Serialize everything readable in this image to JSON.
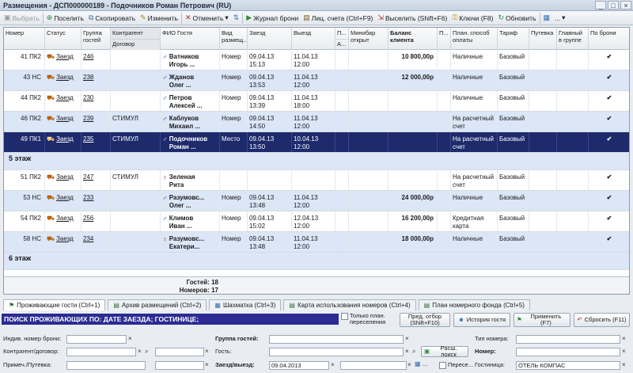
{
  "window": {
    "title": "Размещения - ДСП000000189 - Подочников Роман Петрович (RU)",
    "controls": [
      "_",
      "□",
      "×"
    ]
  },
  "toolbar": {
    "select": "Выбрать",
    "checkin": "Поселить",
    "copy": "Скопировать",
    "edit": "Изменить",
    "cancel": "Отменить",
    "booking_log": "Журнал брони",
    "personal_accounts": "Лиц. счета (Ctrl+F9)",
    "checkout": "Выселить (Shift+F6)",
    "keys": "Ключи (F8)",
    "refresh": "Обновить",
    "more": "..."
  },
  "columns": {
    "room": "Номер",
    "status": "Статус",
    "group": "Группа гостей",
    "contractor": "Контрагент",
    "contract": "Договор",
    "guest": "ФИО Гостя",
    "stay_type": "Вид размещ...",
    "arrival": "Заезд",
    "departure": "Выезд",
    "p": "П...",
    "a": "А...",
    "minibar": "Минибар открыт",
    "balance": "Баланс клиента",
    "p2": "П...",
    "payment": "План. способ оплаты",
    "tariff": "Тариф",
    "voucher": "Путевка",
    "main_in_group": "Главный в группе",
    "by_booking": "По брони"
  },
  "rows": [
    {
      "room": "41 ПК2",
      "status": "Заезд",
      "group": "246",
      "contractor": "",
      "guest": [
        "Ватников",
        "Игорь ..."
      ],
      "gender": "m",
      "stay": "Номер",
      "arrival": "09.04.13 15:13",
      "departure": "11.04.13 12:00",
      "balance": "10 800,00р",
      "payment": [
        "Наличные"
      ],
      "tariff": "Базовый",
      "by_booking": "✔",
      "style": "white"
    },
    {
      "room": "43 НС",
      "status": "Заезд",
      "group": "238",
      "contractor": "",
      "guest": [
        "Жданов",
        "Олег ..."
      ],
      "gender": "m",
      "stay": "Номер",
      "arrival": "09.04.13 13:53",
      "departure": "11.04.13 12:00",
      "balance": "12 000,00р",
      "payment": [
        "Наличные"
      ],
      "tariff": "Базовый",
      "by_booking": "✔",
      "style": "blue"
    },
    {
      "room": "44 ПК2",
      "status": "Заезд",
      "group": "230",
      "contractor": "",
      "guest": [
        "Петров",
        "Алексей ..."
      ],
      "gender": "m",
      "stay": "Номер",
      "arrival": "09.04.13 13:39",
      "departure": "11.04.13 18:00",
      "balance": "",
      "payment": [
        "Наличные"
      ],
      "tariff": "Базовый",
      "by_booking": "✔",
      "style": "white"
    },
    {
      "room": "46 ПК2",
      "status": "Заезд",
      "group": "239",
      "contractor": "СТИМУЛ",
      "guest": [
        "Каблуков",
        "Михаил ..."
      ],
      "gender": "m",
      "stay": "Номер",
      "arrival": "09.04.13 14:50",
      "departure": "11.04.13 12:00",
      "balance": "",
      "payment": [
        "На расчетный",
        "счет"
      ],
      "tariff": "Базовый",
      "by_booking": "✔",
      "style": "blue"
    },
    {
      "room": "49 ПК1",
      "status": "Заезд",
      "group": "235",
      "contractor": "СТИМУЛ",
      "guest": [
        "Подочников",
        "Роман ..."
      ],
      "gender": "m",
      "stay": "Место",
      "arrival": "09.04.13 13:50",
      "departure": "10.04.13 12:00",
      "balance": "",
      "payment": [
        "На расчетный",
        "счет"
      ],
      "tariff": "Базовый",
      "by_booking": "✔",
      "style": "sel"
    },
    {
      "floor": "5 этаж"
    },
    {
      "room": "51 ПК2",
      "status": "Заезд",
      "group": "247",
      "contractor": "СТИМУЛ",
      "guest": [
        "Зеленая",
        "Рита"
      ],
      "gender": "f",
      "stay": "",
      "arrival": "",
      "departure": "",
      "balance": "",
      "payment": [
        "На расчетный",
        "счет"
      ],
      "tariff": "Базовый",
      "by_booking": "✔",
      "style": "white"
    },
    {
      "room": "53 НС",
      "status": "Заезд",
      "group": "233",
      "contractor": "",
      "guest": [
        "Разумовс...",
        "Олег ..."
      ],
      "gender": "m",
      "stay": "Номер",
      "arrival": "09.04.13 13:48",
      "departure": "11.04.13 12:00",
      "balance": "24 000,00р",
      "payment": [
        "Наличные"
      ],
      "tariff": "Базовый",
      "by_booking": "✔",
      "style": "blue"
    },
    {
      "room": "54 ПК2",
      "status": "Заезд",
      "group": "256",
      "contractor": "",
      "guest": [
        "Климов",
        "Иван ..."
      ],
      "gender": "m",
      "stay": "Номер",
      "arrival": "09.04.13 15:02",
      "departure": "12.04.13 12:00",
      "balance": "16 200,00р",
      "payment": [
        "Кредитная",
        "карта"
      ],
      "tariff": "Базовый",
      "by_booking": "✔",
      "style": "white"
    },
    {
      "room": "58 НС",
      "status": "Заезд",
      "group": "234",
      "contractor": "",
      "guest": [
        "Разумовс...",
        "Екатери..."
      ],
      "gender": "f",
      "stay": "Номер",
      "arrival": "09.04.13 13:48",
      "departure": "11.04.13 12:00",
      "balance": "18 000,00р",
      "payment": [
        "Наличные"
      ],
      "tariff": "Базовый",
      "by_booking": "✔",
      "style": "blue"
    },
    {
      "floor": "6 этаж"
    }
  ],
  "summary": {
    "guests": "Гостей: 18",
    "rooms": "Номеров: 17"
  },
  "tabs": [
    "Проживающие гости (Ctrl+1)",
    "Архив размещений (Ctrl+2)",
    "Шахматка (Ctrl+3)",
    "Карта использования номеров (Ctrl+4)",
    "План номерного фонда (Ctrl+5)"
  ],
  "search": {
    "title": "ПОИСК ПРОЖИВАЮЩИХ ПО: ДАТЕ ЗАЕЗДА; ГОСТИНИЦЕ;",
    "only_planned": "Только план. переселения",
    "prev_selection": "Пред. отбор (Shift+F10)",
    "guest_history": "История гостя",
    "apply": "Применить (F7)",
    "reset": "Сбросить (F11)"
  },
  "form": {
    "booking_number": "Индив. номер брони:",
    "contractor": "Контрагент/договор:",
    "note_voucher": "Примеч./Путевка:",
    "group": "Группа гостей:",
    "guest": "Гость:",
    "arrival_departure": "Заезд/выезд:",
    "arrival_value": "09.04.2013",
    "ext_search": "Расш. поиск",
    "transfer": "Пересе...",
    "room_type": "Тип номера:",
    "room": "Номер:",
    "hotel": "Гостиница:",
    "hotel_value": "ОТЕЛЬ КОМПАС"
  }
}
